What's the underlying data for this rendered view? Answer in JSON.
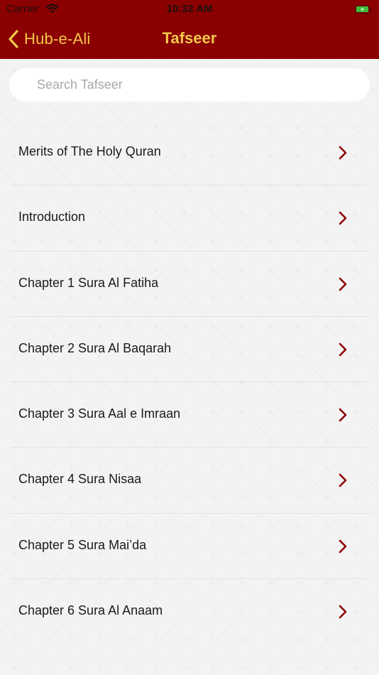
{
  "status_bar": {
    "carrier": "Carrier",
    "time": "10:32 AM"
  },
  "nav": {
    "back_label": "Hub-e-Ali",
    "title": "Tafseer"
  },
  "search": {
    "placeholder": "Search Tafseer",
    "value": ""
  },
  "list": {
    "items": [
      {
        "label": "Merits of The Holy Quran"
      },
      {
        "label": "Introduction"
      },
      {
        "label": "Chapter 1 Sura Al Fatiha"
      },
      {
        "label": "Chapter 2 Sura Al Baqarah"
      },
      {
        "label": "Chapter 3 Sura Aal e Imraan"
      },
      {
        "label": "Chapter 4 Sura Nisaa"
      },
      {
        "label": "Chapter 5 Sura Mai’da"
      },
      {
        "label": "Chapter 6 Sura Al Anaam"
      }
    ]
  },
  "icons": {
    "back": "chevron-left-icon",
    "disclosure": "chevron-right-icon",
    "wifi": "wifi-icon",
    "battery": "battery-charging-icon"
  },
  "colors": {
    "header_bg": "#8b0000",
    "header_text": "#f2c84b",
    "chevron": "#8b0000",
    "battery": "#3bbf3b"
  }
}
